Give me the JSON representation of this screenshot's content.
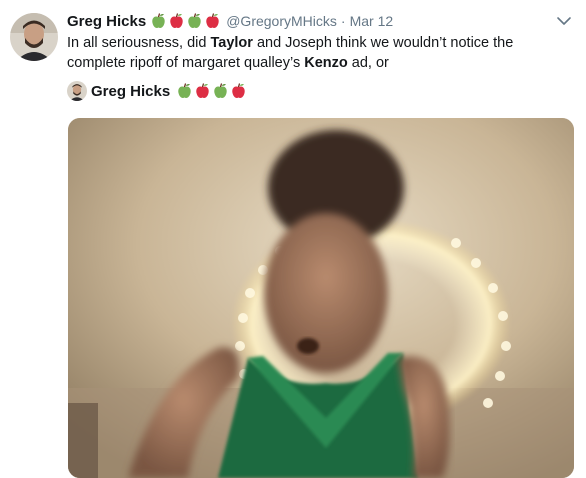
{
  "tweet": {
    "author_name": "Greg Hicks",
    "handle": "@GregoryMHicks",
    "separator": "·",
    "date": "Mar 12",
    "text_parts": {
      "p1": "In all seriousness, did ",
      "b1": "Taylor",
      "p2": " and Joseph think we wouldn’t notice the complete ripoff of margaret qualley’s ",
      "b2": "Kenzo",
      "p3": " ad, or"
    },
    "name_emojis": [
      "green-apple",
      "red-apple",
      "green-apple",
      "red-apple"
    ]
  },
  "quoted": {
    "author_name": "Greg Hicks",
    "name_emojis": [
      "green-apple",
      "red-apple",
      "green-apple",
      "red-apple"
    ]
  },
  "icons": {
    "menu": "chevron-down-icon"
  },
  "colors": {
    "text": "#14171a",
    "secondary": "#657786",
    "green_apple": "#77b255",
    "red_apple": "#dd2e44"
  }
}
